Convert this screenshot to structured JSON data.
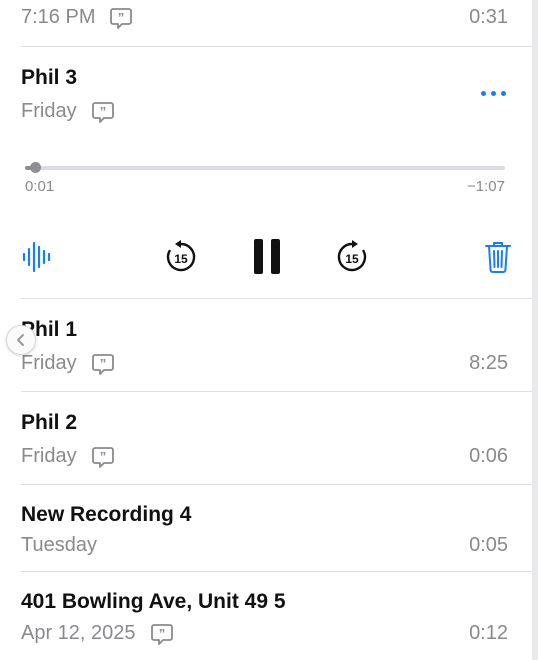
{
  "recordings": [
    {
      "title": "",
      "date": "7:16 PM",
      "has_transcript": true,
      "duration": "0:31"
    },
    {
      "title": "Phil 3",
      "date": "Friday",
      "has_transcript": true,
      "expanded": true,
      "player": {
        "elapsed": "0:01",
        "remaining": "−1:07",
        "progress_fraction": 0.02,
        "skip_seconds": "15",
        "state": "playing"
      }
    },
    {
      "title": "Phil 1",
      "date": "Friday",
      "has_transcript": true,
      "duration": "8:25"
    },
    {
      "title": "Phil 2",
      "date": "Friday",
      "has_transcript": true,
      "duration": "0:06"
    },
    {
      "title": "New Recording 4",
      "date": "Tuesday",
      "has_transcript": false,
      "duration": "0:05"
    },
    {
      "title": "401 Bowling Ave, Unit 49 5",
      "date": "Apr 12, 2025",
      "has_transcript": true,
      "duration": "0:12"
    }
  ],
  "icons": {
    "transcript": "quote-bubble-icon",
    "more": "ellipsis-icon",
    "waveform": "waveform-icon",
    "skip_back": "skip-back-15-icon",
    "pause": "pause-icon",
    "skip_forward": "skip-forward-15-icon",
    "trash": "trash-icon",
    "back": "chevron-left-icon"
  },
  "colors": {
    "accent": "#1a7ef0",
    "primary_text": "#111111",
    "secondary_text": "#8a8a8e",
    "divider": "#dedee2"
  }
}
